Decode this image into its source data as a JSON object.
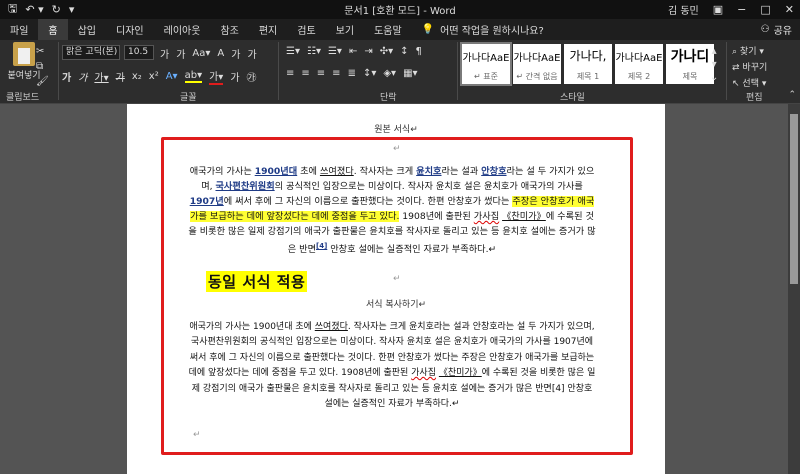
{
  "titlebar": {
    "save_icon": "save-icon",
    "undo_icon": "undo-icon",
    "redo_icon": "redo-icon",
    "title": "문서1 [호환 모드]  -  Word",
    "user": "김 동민",
    "share_icon": "ribbon-display-icon",
    "minimize": "−",
    "restore": "□",
    "close": "✕"
  },
  "tabs": [
    "파일",
    "홈",
    "삽입",
    "디자인",
    "레이아웃",
    "참조",
    "편지",
    "검토",
    "보기",
    "도움말"
  ],
  "active_tab": "홈",
  "tell_me": "어떤 작업을 원하시나요?",
  "share_label": "공유",
  "ribbon": {
    "paste_label": "붙여넣기",
    "clipboard_label": "클립보드",
    "font_name": "맑은 고딕(본)",
    "font_size": "10.5",
    "font_label": "글꼴",
    "paragraph_label": "단락",
    "styles_label": "스타일",
    "editing_label": "편집",
    "styles": [
      {
        "sample": "가나다AaE",
        "name": "↵ 표준"
      },
      {
        "sample": "가나다AaE",
        "name": "↵ 간격 없음"
      },
      {
        "sample": "가나다,",
        "name": "제목 1"
      },
      {
        "sample": "가나다AaE",
        "name": "제목 2"
      },
      {
        "sample": "가나디",
        "name": "제목"
      }
    ],
    "find": "찾기",
    "replace": "바꾸기",
    "select": "선택"
  },
  "document": {
    "heading1": "원본 서식↵",
    "heading2": "서식 복사하기↵",
    "overlay_label": "동일 서식 적용",
    "para1": {
      "t1": "애국가의 가사는 ",
      "link1": "1900년대",
      "t2": " 초에 ",
      "u1": "쓰여졌다",
      "t3": ". 작사자는 크게 ",
      "link2": "윤치호",
      "t4": "라는 설과 ",
      "link3": "안창호",
      "t5": "라는 설 두 가지가 있으며, ",
      "link4": "국사편찬위원회",
      "t6": "의 공식적인 입장으로는 미상이다. 작사자 윤치호 설은 윤치호가 애국가의 가사를 ",
      "link5": "1907년",
      "t7": "에 써서 후에 그 자신의 이름으로 출판했다는 것이다. 한편 안창호가 썼다는 ",
      "hl": "주장은 안창호가 애국가를 보급하는 데에 앞장섰다는 데에 중점을 두고 있다.",
      "t8": " 1908년에 출판된 ",
      "sq1": "가사집",
      "t9": " ",
      "sq2": "《찬미가》",
      "t10": "에 수록된 것을 비롯한 많은 일제 강점기의 애국가 출판물은 윤치호를 작사자로 돌리고 있는 등 윤치호 설에는 증거가 많은 반면",
      "ref": "[4]",
      "t11": " 안창호 설에는 실증적인 자료가 부족하다.↵"
    },
    "para2": {
      "t1": "애국가의 가사는 1900년대 초에 ",
      "u1": "쓰여졌다",
      "t2": ". 작사자는 크게 윤치호라는 설과 안창호라는 설 두 가지가 있으며, 국사편찬위원회의 공식적인 입장으로는 미상이다. 작사자 윤치호 설은 윤치호가 애국가의 가사를 1907년에 써서 후에 그 자신의 이름으로 출판했다는 것이다. 한편 안창호가 썼다는 주장은 안창호가 애국가를 보급하는 데에 앞장섰다는 데에 중점을 두고 있다. 1908년에 출판된 ",
      "sq1": "가사집",
      "t3": " ",
      "sq2": "《찬미가》",
      "t4": "에 수록된 것을 비롯한 많은 일제 강점기의 애국가 출판물은 윤치호를 작사자로 돌리고 있는 등 윤치호 설에는 증거가 많은 반면[4] 안창호 설에는 실증적인 자료가 부족하다.↵"
    },
    "pilcrow": "↵"
  },
  "colors": {
    "highlight": "#ffff33",
    "annotation_box": "#e01c1c",
    "link": "#1f3b86"
  }
}
